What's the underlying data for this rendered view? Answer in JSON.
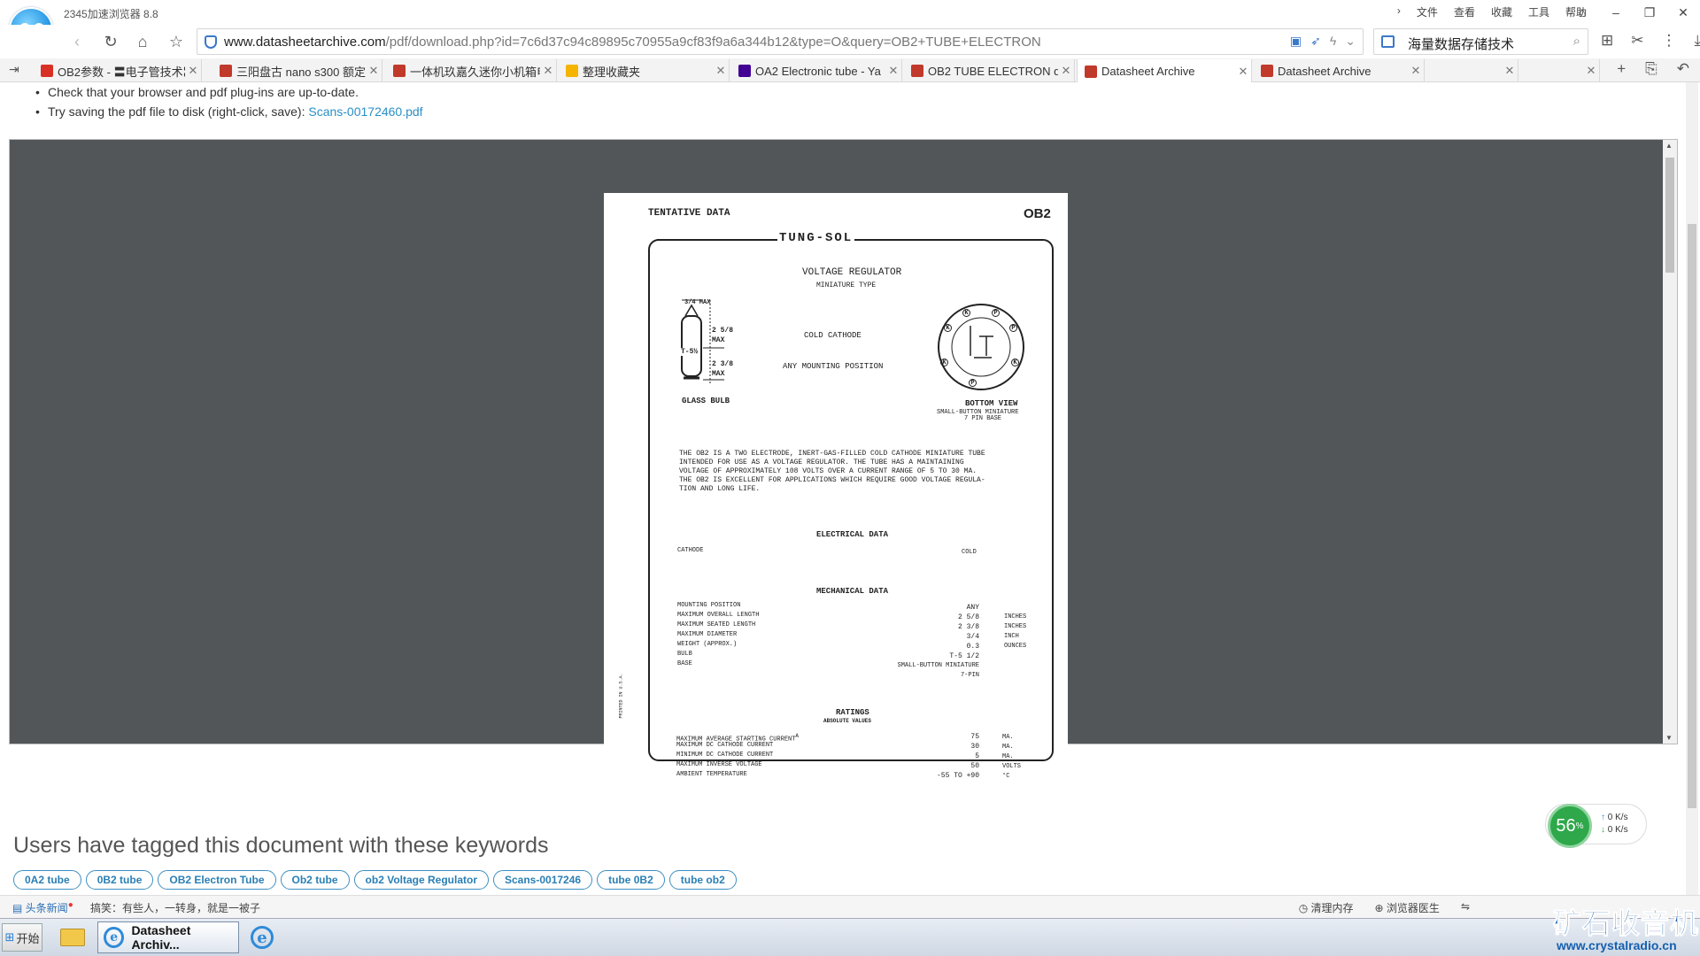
{
  "app": {
    "name": "2345加速浏览器 8.8"
  },
  "menu": [
    "文件",
    "查看",
    "收藏",
    "工具",
    "帮助"
  ],
  "address": {
    "domain": "www.datasheetarchive.com",
    "path": "/pdf/download.php?id=7c6d37c94c89895c70955a9cf83f9a6a344b12&type=O&query=OB2+TUBE+ELECTRON"
  },
  "search": {
    "value": "海量数据存储技术"
  },
  "tabs": [
    {
      "label": "OB2参数 - 〓电子管技术〓",
      "icon_color": "#d93025"
    },
    {
      "label": "三阳盘古 nano s300 额定",
      "icon_color": "#c0392b"
    },
    {
      "label": "一体机玖嘉久迷你小机箱电",
      "icon_color": "#c0392b"
    },
    {
      "label": "整理收藏夹",
      "icon_color": "#f5b400"
    },
    {
      "label": "OA2 Electronic tube - Ya",
      "icon_color": "#410093"
    },
    {
      "label": "OB2 TUBE ELECTRON d",
      "icon_color": "#c0392b"
    },
    {
      "label": "Datasheet Archive",
      "icon_color": "#c0392b"
    },
    {
      "label": "Datasheet Archive",
      "icon_color": "#c0392b"
    },
    {
      "label": "",
      "icon_color": ""
    },
    {
      "label": "",
      "icon_color": ""
    }
  ],
  "tips": {
    "line1": "Check that your browser and pdf plug-ins are up-to-date.",
    "line2": "Try saving the pdf file to disk (right-click, save): ",
    "link": "Scans-00172460.pdf"
  },
  "pdf": {
    "tentative": "TENTATIVE DATA",
    "part": "OB2",
    "brand": "TUNG-SOL",
    "title": "VOLTAGE REGULATOR",
    "subtitle": "MINIATURE TYPE",
    "cold_cathode": "COLD CATHODE",
    "mounting": "ANY MOUNTING POSITION",
    "glass_bulb": "GLASS BULB",
    "dim_top": "3/4 MAX",
    "dim_a": "2 5/8 MAX",
    "dim_b": "2 3/8 MAX",
    "bulb_label": "T-5½",
    "bottom_view": "BOTTOM VIEW",
    "base_desc1": "SMALL-BUTTON MINIATURE",
    "base_desc2": "7 PIN BASE",
    "description": [
      "THE OB2 IS A TWO ELECTRODE, INERT-GAS-FILLED COLD CATHODE MINIATURE TUBE",
      "INTENDED FOR USE AS A VOLTAGE REGULATOR. THE TUBE HAS A MAINTAINING",
      "VOLTAGE OF APPROXIMATELY 108 VOLTS OVER A CURRENT RANGE OF 5 TO 30 MA.",
      "THE OB2 IS EXCELLENT FOR APPLICATIONS WHICH REQUIRE GOOD VOLTAGE REGULA-",
      "TION AND LONG LIFE."
    ],
    "electrical_title": "ELECTRICAL DATA",
    "electrical": [
      {
        "name": "CATHODE",
        "value": "COLD",
        "unit": ""
      }
    ],
    "mechanical_title": "MECHANICAL DATA",
    "mechanical": [
      {
        "name": "MOUNTING POSITION",
        "value": "ANY",
        "unit": ""
      },
      {
        "name": "MAXIMUM OVERALL LENGTH",
        "value": "2 5/8",
        "unit": "INCHES"
      },
      {
        "name": "MAXIMUM SEATED LENGTH",
        "value": "2 3/8",
        "unit": "INCHES"
      },
      {
        "name": "MAXIMUM DIAMETER",
        "value": "3/4",
        "unit": "INCH"
      },
      {
        "name": "WEIGHT (APPROX.)",
        "value": "0.3",
        "unit": "OUNCES"
      },
      {
        "name": "BULB",
        "value": "T-5 1/2",
        "unit": ""
      },
      {
        "name": "BASE",
        "value": "SMALL-BUTTON MINIATURE",
        "unit": ""
      },
      {
        "name": "",
        "value": "7-PIN",
        "unit": ""
      }
    ],
    "ratings_title": "RATINGS",
    "ratings_sub": "ABSOLUTE VALUES",
    "ratings": [
      {
        "name": "MAXIMUM AVERAGE STARTING CURRENT",
        "sup": "A",
        "value": "75",
        "unit": "MA."
      },
      {
        "name": "MAXIMUM DC CATHODE CURRENT",
        "sup": "",
        "value": "30",
        "unit": "MA."
      },
      {
        "name": "MINIMUM DC CATHODE CURRENT",
        "sup": "",
        "value": "5",
        "unit": "MA."
      },
      {
        "name": "MAXIMUM INVERSE VOLTAGE",
        "sup": "",
        "value": "50",
        "unit": "VOLTS"
      },
      {
        "name": "AMBIENT TEMPERATURE",
        "sup": "",
        "value": "-55 TO +90",
        "unit": "°C"
      }
    ],
    "margin_note": "PRINTED IN U.S.A.",
    "pins": [
      "K",
      "P",
      "K",
      "K",
      "P",
      "K",
      "P"
    ]
  },
  "keywords": {
    "title": "Users have tagged this document with these keywords",
    "items": [
      "0A2 tube",
      "0B2 tube",
      "OB2 Electron Tube",
      "Ob2 tube",
      "ob2 Voltage Regulator",
      "Scans-0017246",
      "tube 0B2",
      "tube ob2"
    ]
  },
  "speed": {
    "percent": "56",
    "up": "0 K/s",
    "down": "0 K/s"
  },
  "status": {
    "news": "头条新闻",
    "joke": "搞笑：有些人，一转身，就是一被子",
    "clean": "清理内存",
    "doctor": "浏览器医生"
  },
  "taskbar": {
    "start": "开始",
    "active": "Datasheet Archiv..."
  },
  "watermark": {
    "big": "矿石收音机",
    "small": "www.crystalradio.cn"
  }
}
